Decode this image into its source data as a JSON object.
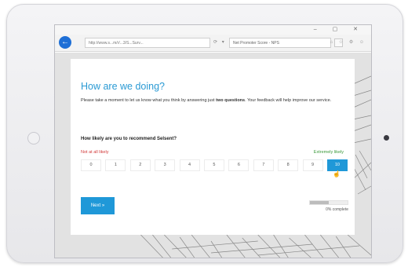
{
  "browser": {
    "window_controls": "–  ▢  ✕",
    "back_glyph": "←",
    "address": "http://www.s...m/r/...3/S...Surv...",
    "address_icons": "⟳ ▾",
    "tab_title": "Net Promoter Score - NPS",
    "toolbar_icons": "⌂ ☆ ⚙ ☺"
  },
  "survey": {
    "title": "How are we doing?",
    "intro_prefix": "Please take a moment to let us know what you think by answering just ",
    "intro_bold": "two questions",
    "intro_suffix": ". Your feedback will help improve our service.",
    "question": "How likely are you to recommend Selsent?",
    "low_label": "Not at all likely",
    "high_label": "Extremely likely",
    "scale": [
      "0",
      "1",
      "2",
      "3",
      "4",
      "5",
      "6",
      "7",
      "8",
      "9",
      "10"
    ],
    "selected_value": "10",
    "next_label": "Next »",
    "progress_fraction": 0.5,
    "progress_text": "0% complete"
  },
  "colors": {
    "accent": "#1f98d8",
    "title_blue": "#2a9ad4",
    "low_red": "#d23b3b",
    "high_green": "#3b9a3b"
  }
}
